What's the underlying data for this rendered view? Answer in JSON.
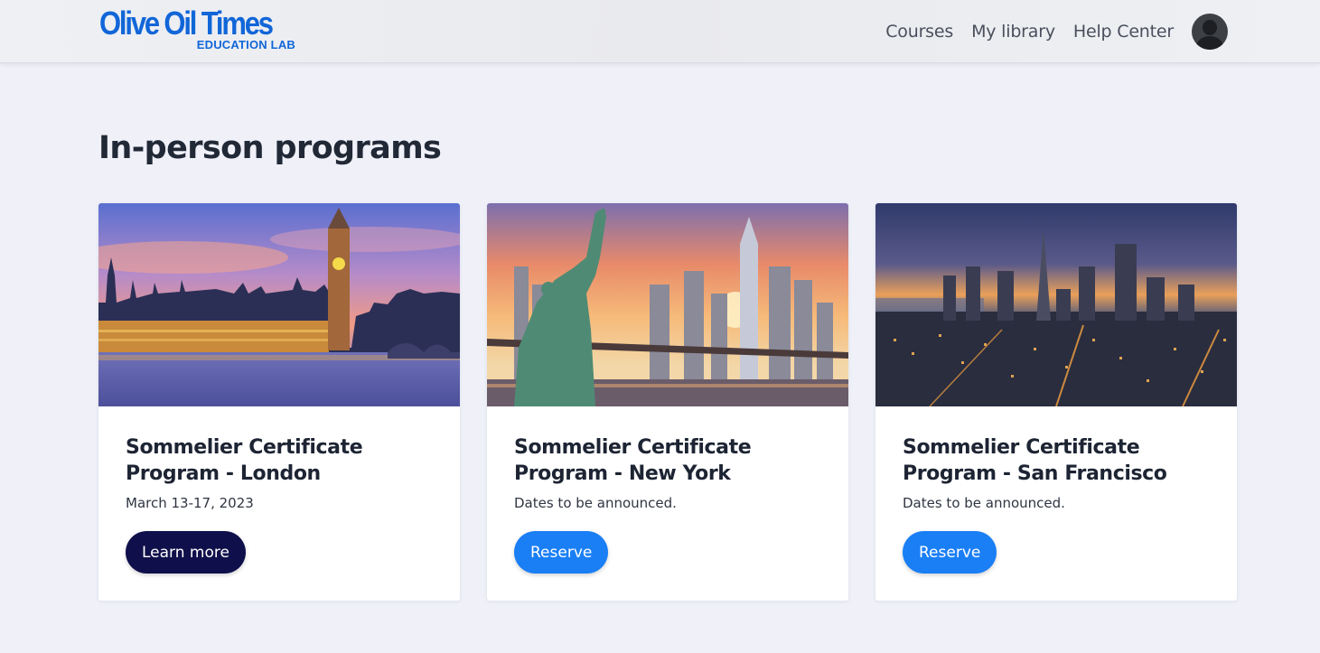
{
  "header": {
    "logo_main": "Olive Oil Times",
    "logo_sub": "EDUCATION LAB",
    "nav": [
      "Courses",
      "My library",
      "Help Center"
    ],
    "brand_color": "#1166d8"
  },
  "main": {
    "title": "In-person programs",
    "cards": [
      {
        "title": "Sommelier Certificate Program - London",
        "date": "March 13-17, 2023",
        "button": "Learn more",
        "button_color": "#0f0f4b",
        "image": "london-skyline-big-ben"
      },
      {
        "title": "Sommelier Certificate Program - New York",
        "date": "Dates to be announced.",
        "button": "Reserve",
        "button_color": "#1a7ff5",
        "image": "new-york-statue-of-liberty"
      },
      {
        "title": "Sommelier Certificate Program - San Francisco",
        "date": "Dates to be announced.",
        "button": "Reserve",
        "button_color": "#1a7ff5",
        "image": "san-francisco-night-skyline"
      }
    ]
  }
}
